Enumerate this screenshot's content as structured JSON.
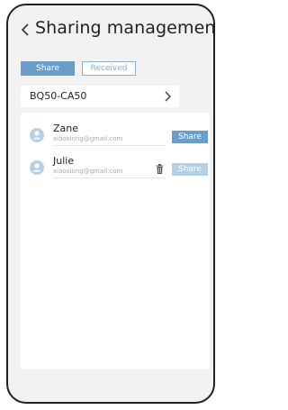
{
  "header": {
    "title": "Sharing management",
    "back_icon": "chevron-left-icon"
  },
  "tabs": [
    {
      "label": "Share",
      "active": true
    },
    {
      "label": "Received",
      "active": false
    }
  ],
  "device": {
    "name": "BQ50-CA50",
    "arrow_icon": "chevron-right-icon"
  },
  "users": [
    {
      "name": "Zane",
      "email": "xiaoxiong@gmail.com",
      "share_label": "Share",
      "share_enabled": true
    },
    {
      "name": "Julie",
      "email": "xiaoxiong@gmail.com",
      "share_label": "Share",
      "share_enabled": false,
      "delete_icon": "trash-icon"
    }
  ],
  "colors": {
    "accent": "#6a9dc8",
    "accent_disabled": "#b7cfe4",
    "avatar": "#b7cfe4",
    "background": "#f2f2f2"
  }
}
